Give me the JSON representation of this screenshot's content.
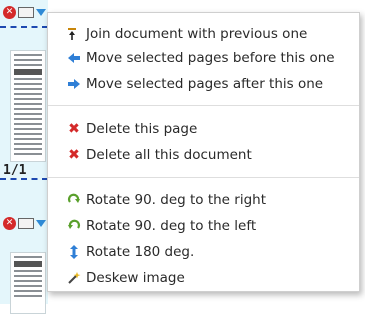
{
  "page_counter": "1/1",
  "menu": {
    "groups": [
      [
        {
          "label": "Join document with previous one",
          "icon": "join-pages-icon"
        },
        {
          "label": "Move selected pages before this one",
          "icon": "arrow-left-icon"
        },
        {
          "label": "Move selected pages after this one",
          "icon": "arrow-right-icon"
        }
      ],
      [
        {
          "label": "Delete this page",
          "icon": "delete-x-icon"
        },
        {
          "label": "Delete all this document",
          "icon": "delete-x-icon"
        }
      ],
      [
        {
          "label": "Rotate 90. deg to the right",
          "icon": "rotate-right-icon"
        },
        {
          "label": "Rotate 90. deg to the left",
          "icon": "rotate-left-icon"
        },
        {
          "label": "Rotate 180 deg.",
          "icon": "rotate-180-icon"
        },
        {
          "label": "Deskew image",
          "icon": "magic-wand-icon"
        }
      ]
    ]
  },
  "colors": {
    "strip_bg": "#e4f6fb",
    "delete": "#d42a2a",
    "move_arrow": "#2f7fd6",
    "rotate": "#5aa02c"
  }
}
